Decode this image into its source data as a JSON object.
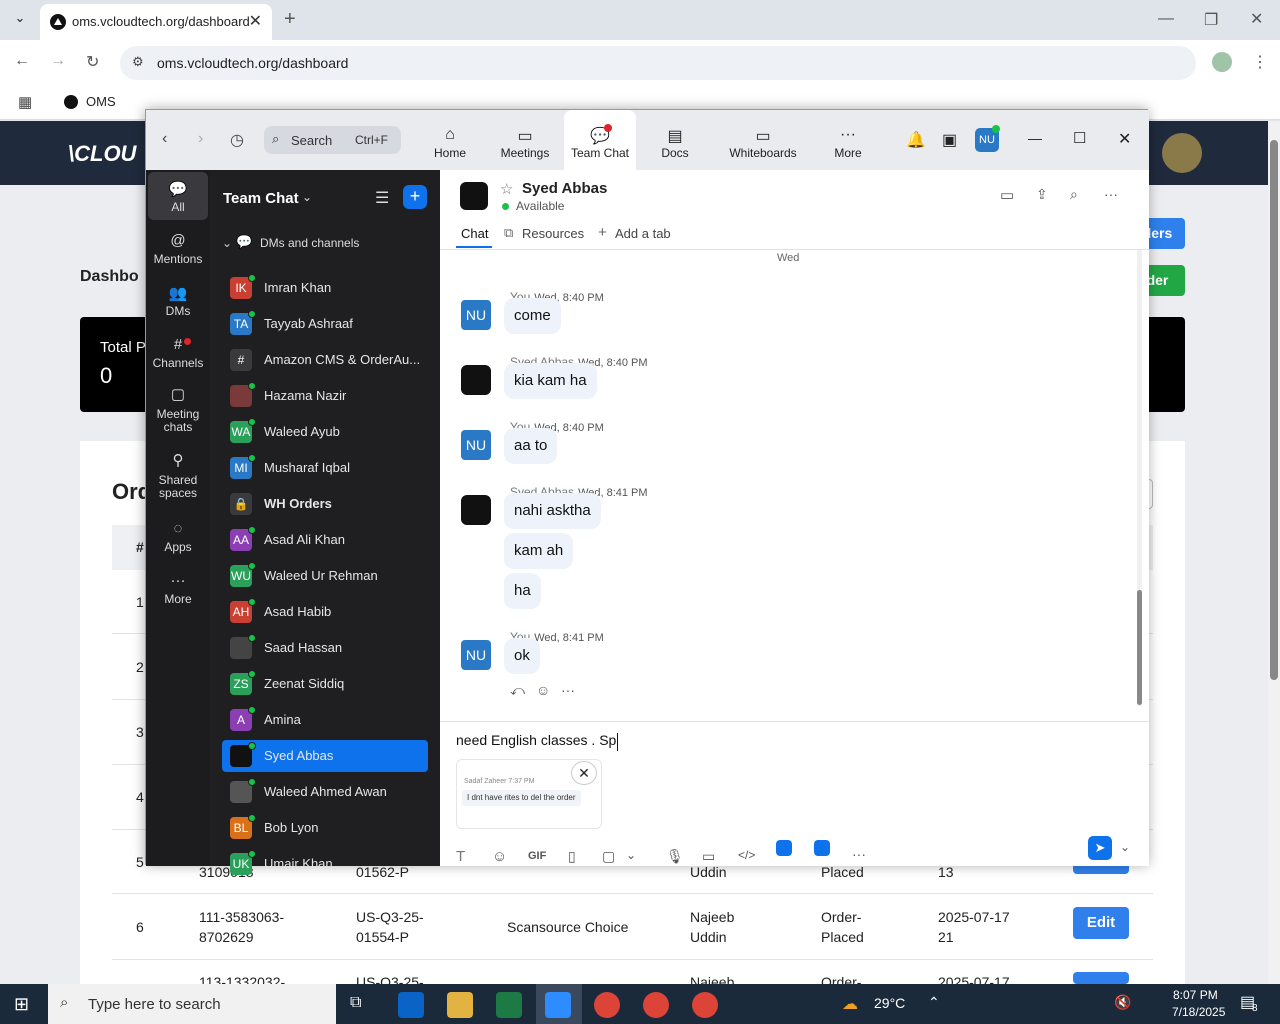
{
  "browser": {
    "tab_title": "oms.vcloudtech.org/dashboard",
    "url": "oms.vcloudtech.org/dashboard",
    "bookmark": "OMS"
  },
  "site": {
    "logo_text": "\\CLOU",
    "page_title": "Dashbo",
    "total_label": "Total Pa",
    "total_value": "0",
    "orders_heading": "Ord",
    "btn_orders": "ders",
    "btn_new": "der",
    "table_hash": "#",
    "left_nums": [
      "1",
      "2",
      "3",
      "4",
      "5"
    ],
    "rows": [
      {
        "n": "5",
        "order": "3109018",
        "sku": "01562-P",
        "vendor": "Scansource Choice",
        "user": "Uddin",
        "status": "Placed",
        "date": "13",
        "edit": "Edit"
      },
      {
        "n": "6",
        "order": "111-3583063-\n8702629",
        "sku": "US-Q3-25-\n01554-P",
        "vendor": "Scansource Choice",
        "user": "Najeeb\nUddin",
        "status": "Order-\nPlaced",
        "date": "2025-07-17\n21",
        "edit": "Edit"
      },
      {
        "n": "",
        "order": "113-1332032-",
        "sku": "US-Q3-25-",
        "vendor": "",
        "user": "Najeeb",
        "status": "Order-",
        "date": "2025-07-17",
        "edit": "Edit"
      }
    ]
  },
  "zoom": {
    "search_label": "Search",
    "search_shortcut": "Ctrl+F",
    "nav": [
      "Home",
      "Meetings",
      "Team Chat",
      "Docs",
      "Whiteboards",
      "More"
    ],
    "user_initials": "NU",
    "rail": [
      "All",
      "Mentions",
      "DMs",
      "Channels",
      "Meeting chats",
      "Shared spaces",
      "Apps",
      "More"
    ],
    "list_title": "Team Chat",
    "section": "DMs and channels",
    "contacts": [
      {
        "initials": "IK",
        "name": "Imran Khan",
        "color": "#c94033"
      },
      {
        "initials": "TA",
        "name": "Tayyab Ashraaf",
        "color": "#2a79c6"
      },
      {
        "initials": "#",
        "name": "Amazon CMS & OrderAu...",
        "color": "#3a3a3c"
      },
      {
        "initials": "",
        "name": "Hazama Nazir",
        "color": "#7a3a3a"
      },
      {
        "initials": "WA",
        "name": "Waleed Ayub",
        "color": "#2aa05a"
      },
      {
        "initials": "MI",
        "name": "Musharaf Iqbal",
        "color": "#2a79c6"
      },
      {
        "initials": "🔒",
        "name": "WH Orders",
        "color": "#3a3a3c"
      },
      {
        "initials": "AA",
        "name": "Asad Ali Khan",
        "color": "#8b3fb3"
      },
      {
        "initials": "WU",
        "name": "Waleed Ur Rehman",
        "color": "#2aa05a"
      },
      {
        "initials": "AH",
        "name": "Asad Habib",
        "color": "#c94033"
      },
      {
        "initials": "",
        "name": "Saad Hassan",
        "color": "#444"
      },
      {
        "initials": "ZS",
        "name": "Zeenat Siddiq",
        "color": "#2aa05a"
      },
      {
        "initials": "A",
        "name": "Amina",
        "color": "#8b3fb3"
      },
      {
        "initials": "",
        "name": "Syed Abbas",
        "color": "#111"
      },
      {
        "initials": "",
        "name": "Waleed Ahmed Awan",
        "color": "#555"
      },
      {
        "initials": "BL",
        "name": "Bob Lyon",
        "color": "#d9701a"
      },
      {
        "initials": "UK",
        "name": "Umair Khan",
        "color": "#2aa05a"
      }
    ],
    "chat": {
      "name": "Syed Abbas",
      "status": "Available",
      "tabs": [
        "Chat",
        "Resources",
        "Add a tab"
      ],
      "day": "Wed",
      "messages": [
        {
          "who": "You",
          "time": "Wed, 8:40 PM",
          "texts": [
            "come"
          ]
        },
        {
          "who": "Syed Abbas",
          "time": "Wed, 8:40 PM",
          "texts": [
            "kia kam ha"
          ]
        },
        {
          "who": "You",
          "time": "Wed, 8:40 PM",
          "texts": [
            "aa to"
          ]
        },
        {
          "who": "Syed Abbas",
          "time": "Wed, 8:41 PM",
          "texts": [
            "nahi asktha",
            "kam ah",
            "ha"
          ]
        },
        {
          "who": "You",
          "time": "Wed, 8:41 PM",
          "texts": [
            "ok"
          ]
        }
      ],
      "compose_text": "need English classes . Sp",
      "quote_author": "Sadaf Zaheer 7:37 PM",
      "quote_text": "I dnt have rites to del the order",
      "gif": "GIF"
    }
  },
  "taskbar": {
    "search_placeholder": "Type here to search",
    "weather": "29°C",
    "time": "8:07 PM",
    "date": "7/18/2025",
    "notif_count": "8"
  }
}
